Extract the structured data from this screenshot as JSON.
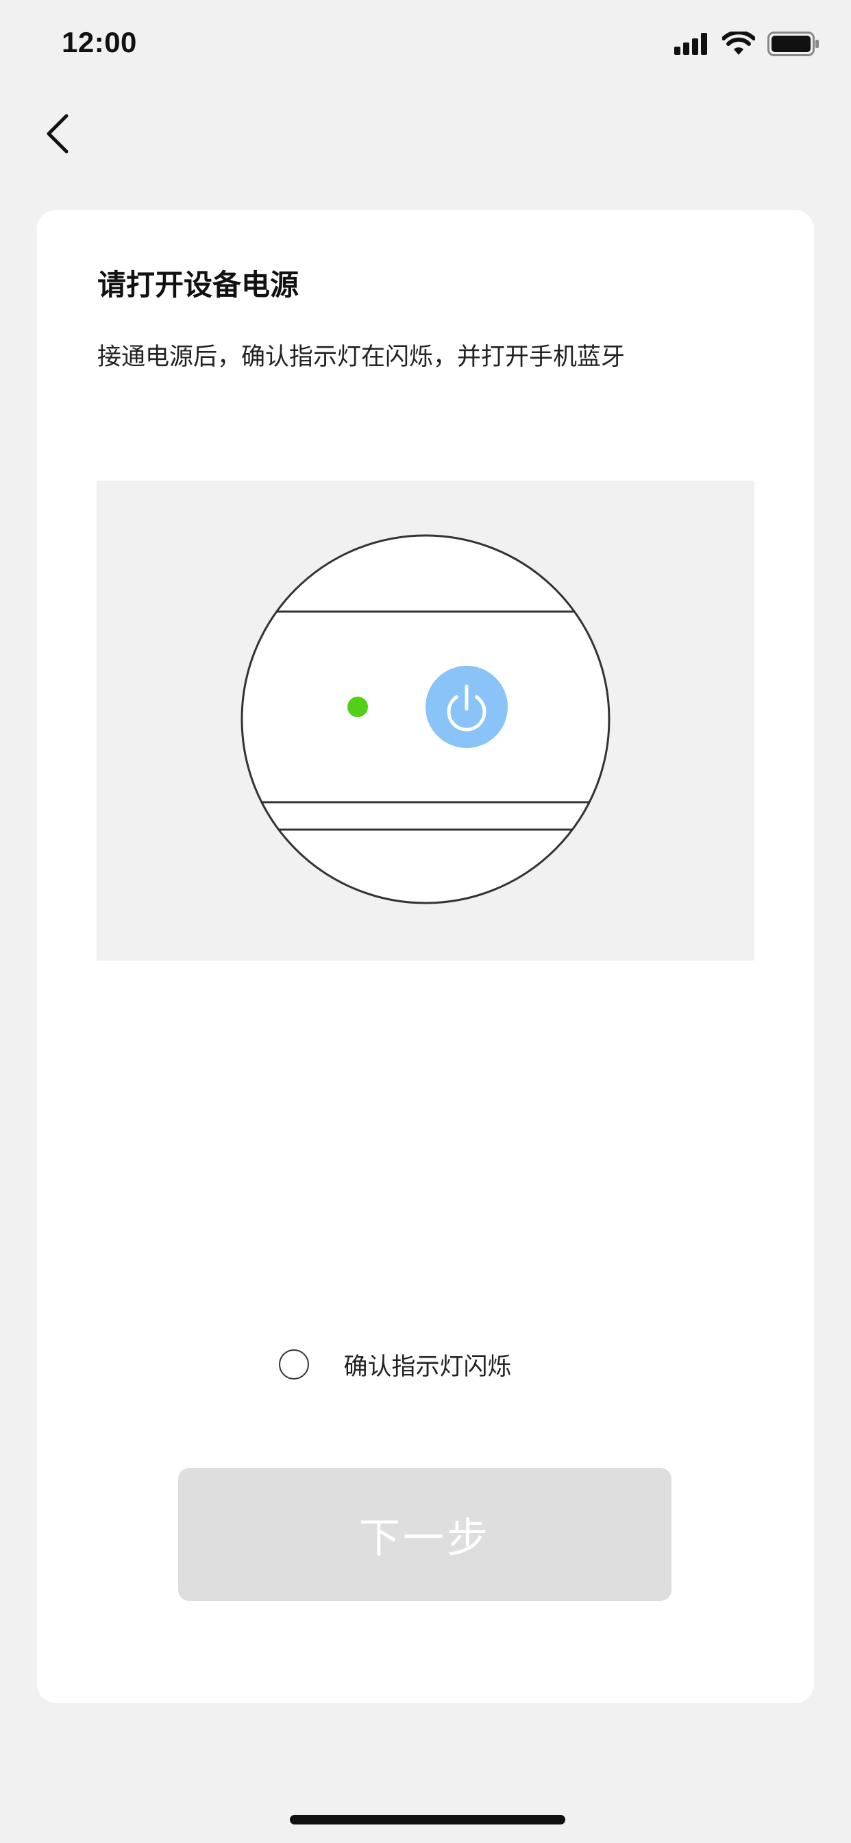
{
  "status_bar": {
    "time": "12:00"
  },
  "navigation": {
    "back_icon": "chevron-left-icon"
  },
  "card": {
    "title": "请打开设备电源",
    "description": "接通电源后，确认指示灯在闪烁，并打开手机蓝牙"
  },
  "illustration": {
    "indicator_color": "#52d017",
    "power_button_color": "#89c3f8",
    "power_icon": "power-icon"
  },
  "confirm": {
    "label": "确认指示灯闪烁",
    "checked": false
  },
  "next_button": {
    "label": "下一步",
    "enabled": false
  },
  "colors": {
    "page_background": "#f1f1f1",
    "card_background": "#ffffff",
    "button_disabled": "#dedede"
  }
}
